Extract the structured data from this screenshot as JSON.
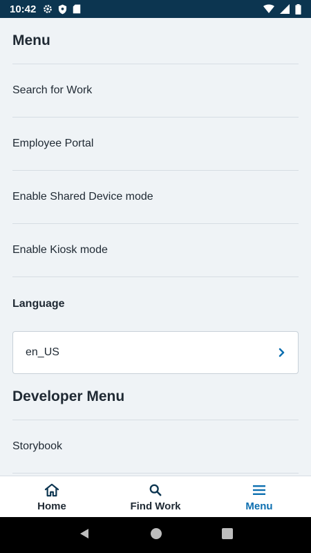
{
  "status_bar": {
    "time": "10:42"
  },
  "menu": {
    "title": "Menu",
    "items": [
      {
        "label": "Search for Work"
      },
      {
        "label": "Employee Portal"
      },
      {
        "label": "Enable Shared Device mode"
      },
      {
        "label": "Enable Kiosk mode"
      }
    ]
  },
  "language": {
    "heading": "Language",
    "value": "en_US"
  },
  "developer_menu": {
    "title": "Developer Menu",
    "items": [
      {
        "label": "Storybook"
      }
    ]
  },
  "bottom_nav": {
    "tabs": [
      {
        "label": "Home",
        "icon": "home-icon"
      },
      {
        "label": "Find Work",
        "icon": "search-icon"
      },
      {
        "label": "Menu",
        "icon": "hamburger-icon",
        "active": true
      }
    ]
  },
  "colors": {
    "status_bar": "#0c3550",
    "accent": "#0d6fb0",
    "background": "#eff3f6"
  }
}
